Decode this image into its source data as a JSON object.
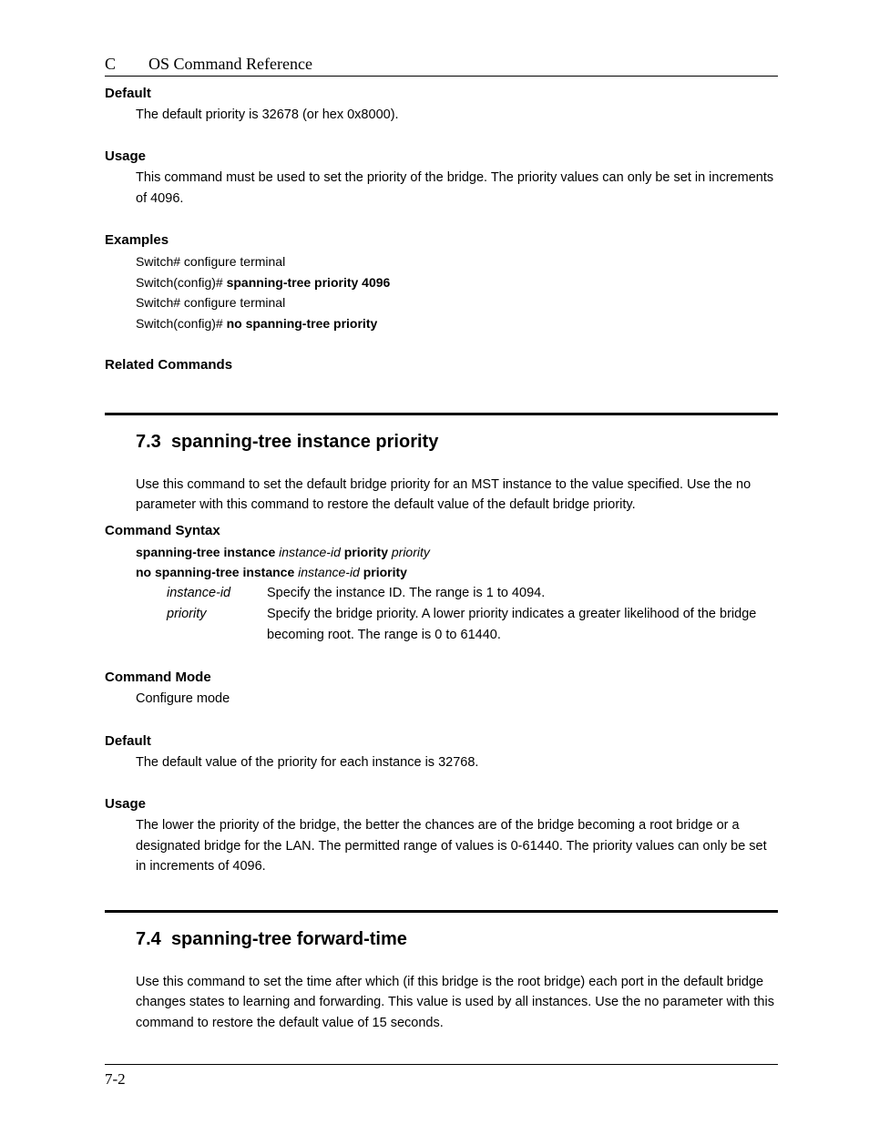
{
  "header": {
    "chapter_letter": "C",
    "title": "OS Command Reference"
  },
  "sec_default1": {
    "label": "Default",
    "text": "The default priority is 32678 (or hex 0x8000)."
  },
  "sec_usage1": {
    "label": "Usage",
    "text": "This command must be used to set the priority of the bridge. The priority values can only be set in increments of 4096."
  },
  "sec_examples": {
    "label": "Examples",
    "line1_a": "Switch# configure terminal",
    "line2_a": "Switch(config)# ",
    "line2_b": "spanning-tree priority 4096",
    "line3_a": "Switch# configure terminal",
    "line4_a": "Switch(config)# ",
    "line4_b": "no spanning-tree priority"
  },
  "sec_related": {
    "label": "Related Commands"
  },
  "sec73": {
    "number": "7.3",
    "title": "spanning-tree instance priority",
    "intro": "Use this command to set the default bridge priority for an MST instance to the value specified. Use the no parameter with this command to restore the default value of the default bridge priority.",
    "cmdsyntax_label": "Command Syntax",
    "syn1_a": "spanning-tree instance ",
    "syn1_b": "instance-id",
    "syn1_c": " priority ",
    "syn1_d": "priority",
    "syn2_a": "no spanning-tree instance ",
    "syn2_b": "instance-id",
    "syn2_c": " priority",
    "param1_name": "instance-id",
    "param1_desc": "Specify the instance ID. The range is 1 to 4094.",
    "param2_name": "priority",
    "param2_desc": "Specify the bridge priority. A lower priority indicates a greater likelihood of the bridge becoming root. The range is 0 to 61440.",
    "cmdmode_label": "Command Mode",
    "cmdmode_text": "Configure mode",
    "default_label": "Default",
    "default_text": "The default value of the priority for each instance is 32768.",
    "usage_label": "Usage",
    "usage_text": "The lower the priority of the bridge, the better the chances are of the bridge becoming a root bridge or a designated bridge for the LAN. The permitted range of values is 0-61440. The priority values can only be set in increments of 4096."
  },
  "sec74": {
    "number": "7.4",
    "title": "spanning-tree forward-time",
    "intro": "Use this command to set the time after which (if this bridge is the root bridge) each port in the default bridge changes states to learning and forwarding. This value is used by all instances. Use the no parameter with this command to restore the default value of 15 seconds."
  },
  "footer": {
    "page": "7-2"
  }
}
